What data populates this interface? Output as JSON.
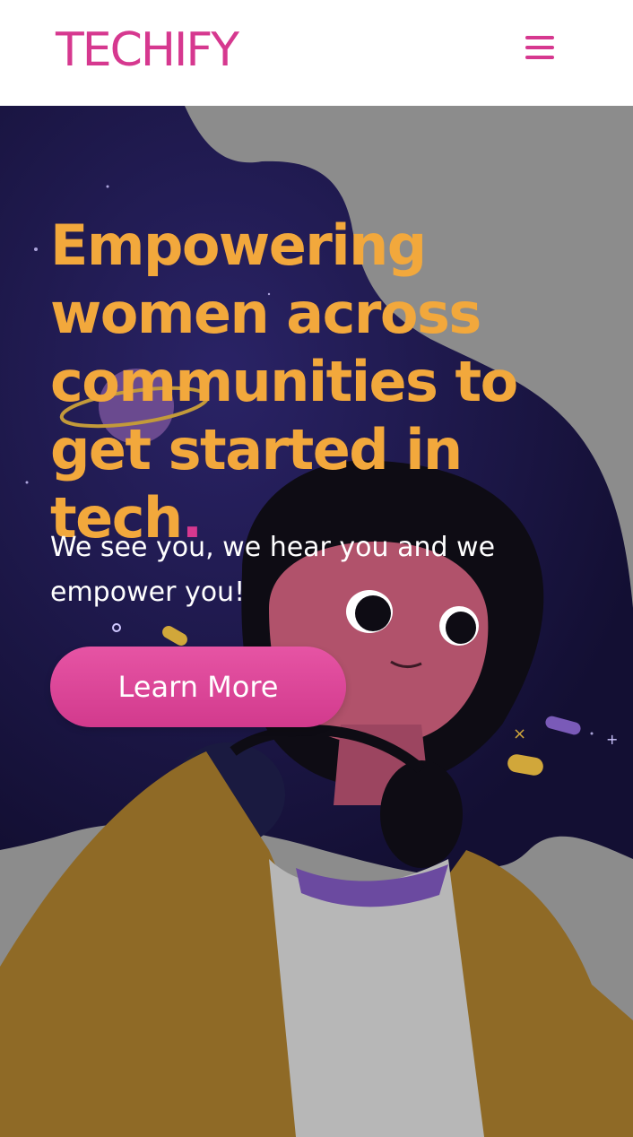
{
  "header": {
    "logo_text": "TECHIFY",
    "menu_icon": "hamburger-menu-icon"
  },
  "hero": {
    "title": "Empowering women across communities to get started in tech",
    "title_dot": ".",
    "subtitle": "We see you, we hear you and we empower you!",
    "cta_label": "Learn More"
  },
  "colors": {
    "brand_pink": "#d6388f",
    "title_orange": "#f2a83c",
    "night_sky": "#1e1747",
    "jacket_mustard": "#8f6a26",
    "background_gray": "#8c8c8c"
  }
}
